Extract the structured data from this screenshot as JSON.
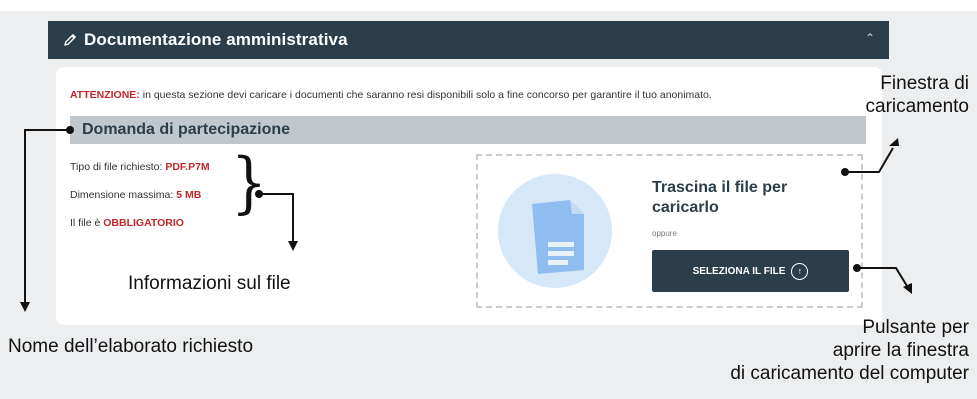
{
  "header": {
    "icon": "pencil-icon",
    "title": "Documentazione amministrativa",
    "collapse_icon": "chevron-up-icon"
  },
  "warning": {
    "label": "ATTENZIONE:",
    "text": " in questa sezione devi caricare i documenti che saranno resi disponibili solo a fine concorso per garantire il tuo anonimato."
  },
  "section": {
    "title": "Domanda di partecipazione"
  },
  "file_info": {
    "type_label": "Tipo di file richiesto: ",
    "type_value": "PDF.P7M",
    "size_label": "Dimensione massima: ",
    "size_value": "5 MB",
    "required_label": "Il file è ",
    "required_value": "OBBLIGATORIO"
  },
  "upload": {
    "drop_text": "Trascina il file per caricarlo",
    "or_text": "oppure",
    "button_label": "SELEZIONA IL FILE",
    "button_icon": "upload-arrow-icon",
    "illustration": "document-icon"
  },
  "annotations": {
    "window": [
      "Finestra di",
      "caricamento"
    ],
    "file_info": "Informazioni sul file",
    "name": "Nome dell’elaborato richiesto",
    "button": [
      "Pulsante per",
      "aprire la finestra",
      "di caricamento del computer"
    ]
  },
  "colors": {
    "header_bg": "#2c3e4a",
    "accent_red": "#c1272d",
    "section_bar": "#c1c8cd",
    "page_bg": "#eceeef"
  }
}
